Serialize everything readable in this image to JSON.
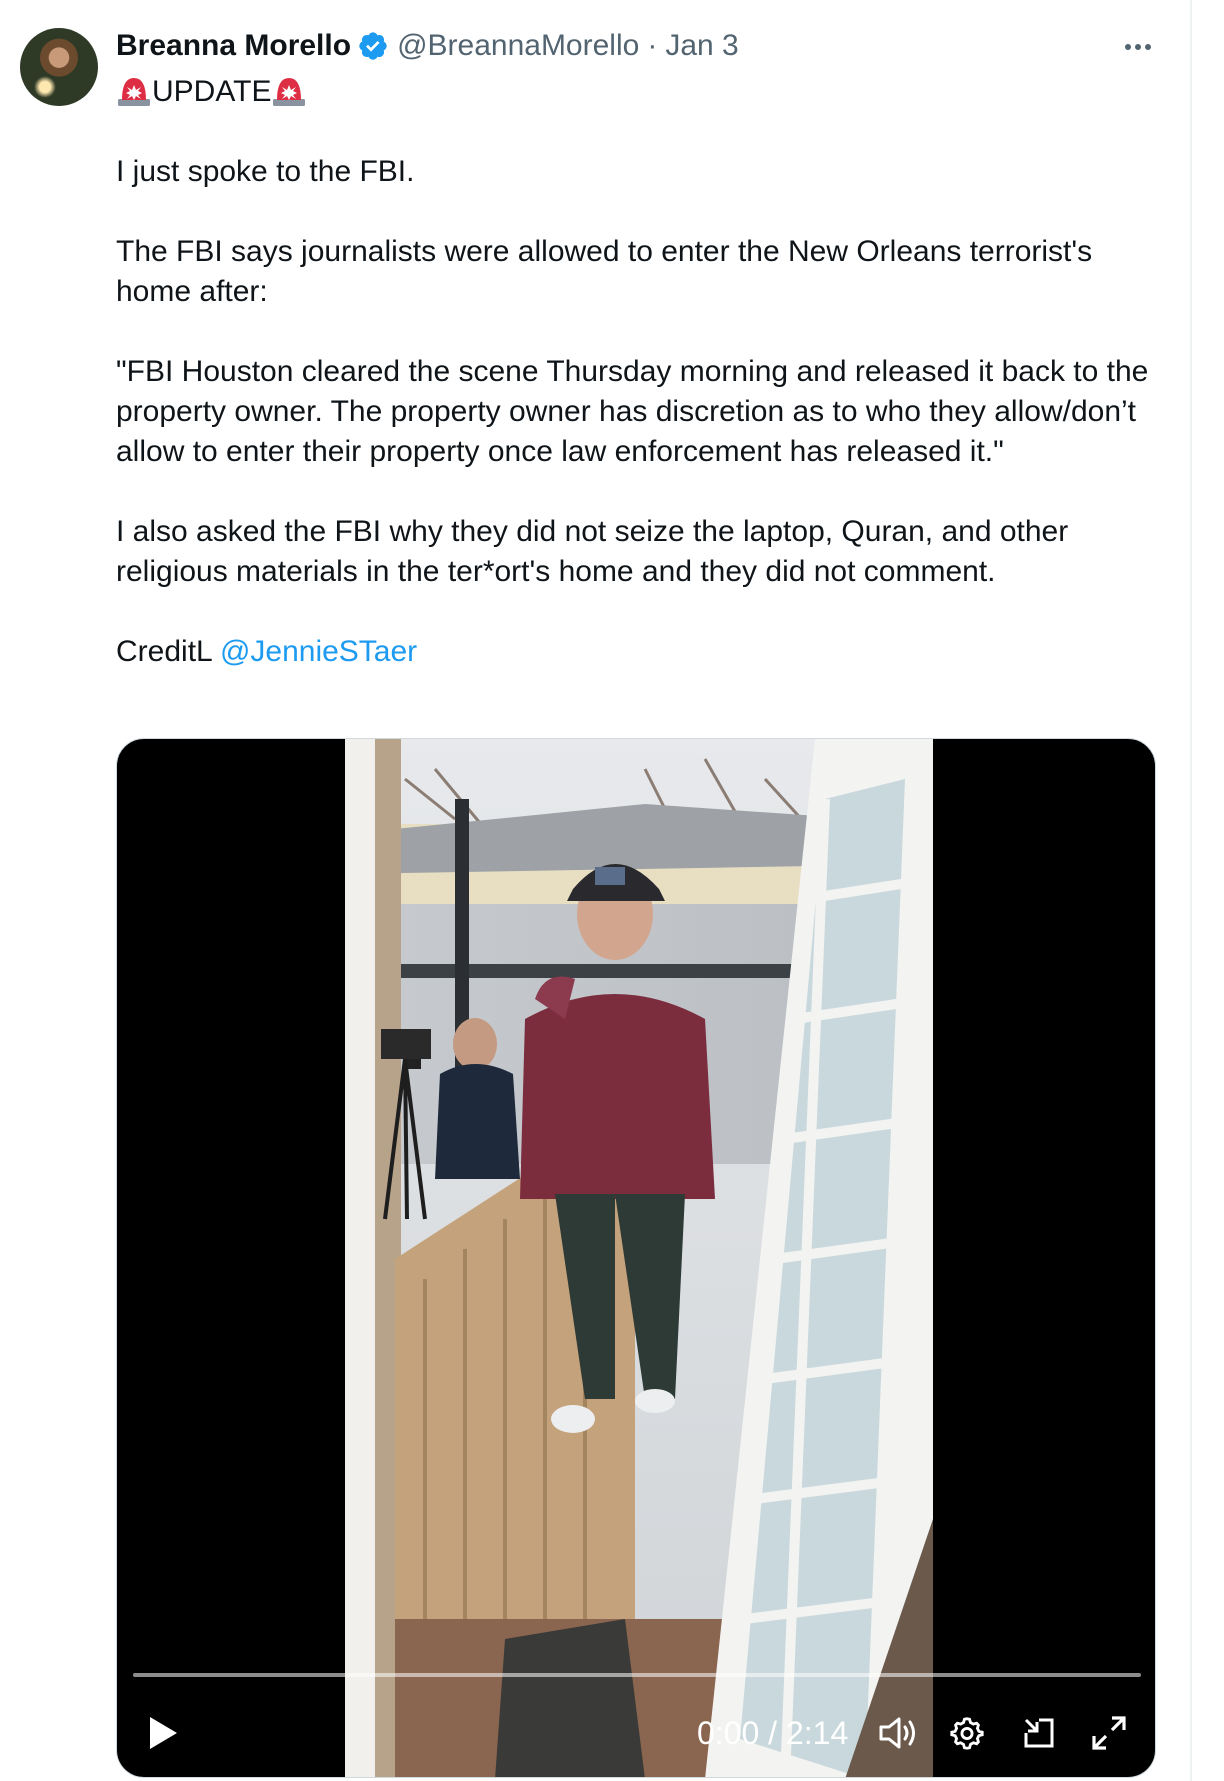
{
  "author": {
    "name": "Breanna Morello",
    "handle": "@BreannaMorello",
    "separator": "·",
    "date": "Jan 3"
  },
  "tweet": {
    "line_update": "UPDATE",
    "line_1": "I just spoke to the FBI.",
    "line_2": "The FBI says journalists were allowed to enter the New Orleans terrorist's home after:",
    "line_3": "\"FBI Houston cleared the scene Thursday morning and released it back to the property owner. The property owner has discretion as to who they allow/don’t allow to enter their property once law enforcement has released it.\"",
    "line_4": "I also asked the FBI why they did not seize the laptop, Quran, and other religious materials in the ter*ort's home and they did not comment.",
    "credit_prefix": "CreditL ",
    "credit_mention": "@JennieSTaer"
  },
  "video": {
    "time_display": "0:00 / 2:14",
    "progress": 0.0
  },
  "icons": {
    "verified": "verified-badge-icon",
    "more": "more-options-icon",
    "siren": "police-light-emoji-icon",
    "play": "play-icon",
    "volume": "volume-icon",
    "settings": "gear-icon",
    "pip": "picture-in-picture-icon",
    "fullscreen": "fullscreen-icon"
  },
  "colors": {
    "link": "#1d9bf0",
    "secondary_text": "#536471",
    "primary_text": "#0f1419",
    "verified": "#1d9bf0"
  }
}
